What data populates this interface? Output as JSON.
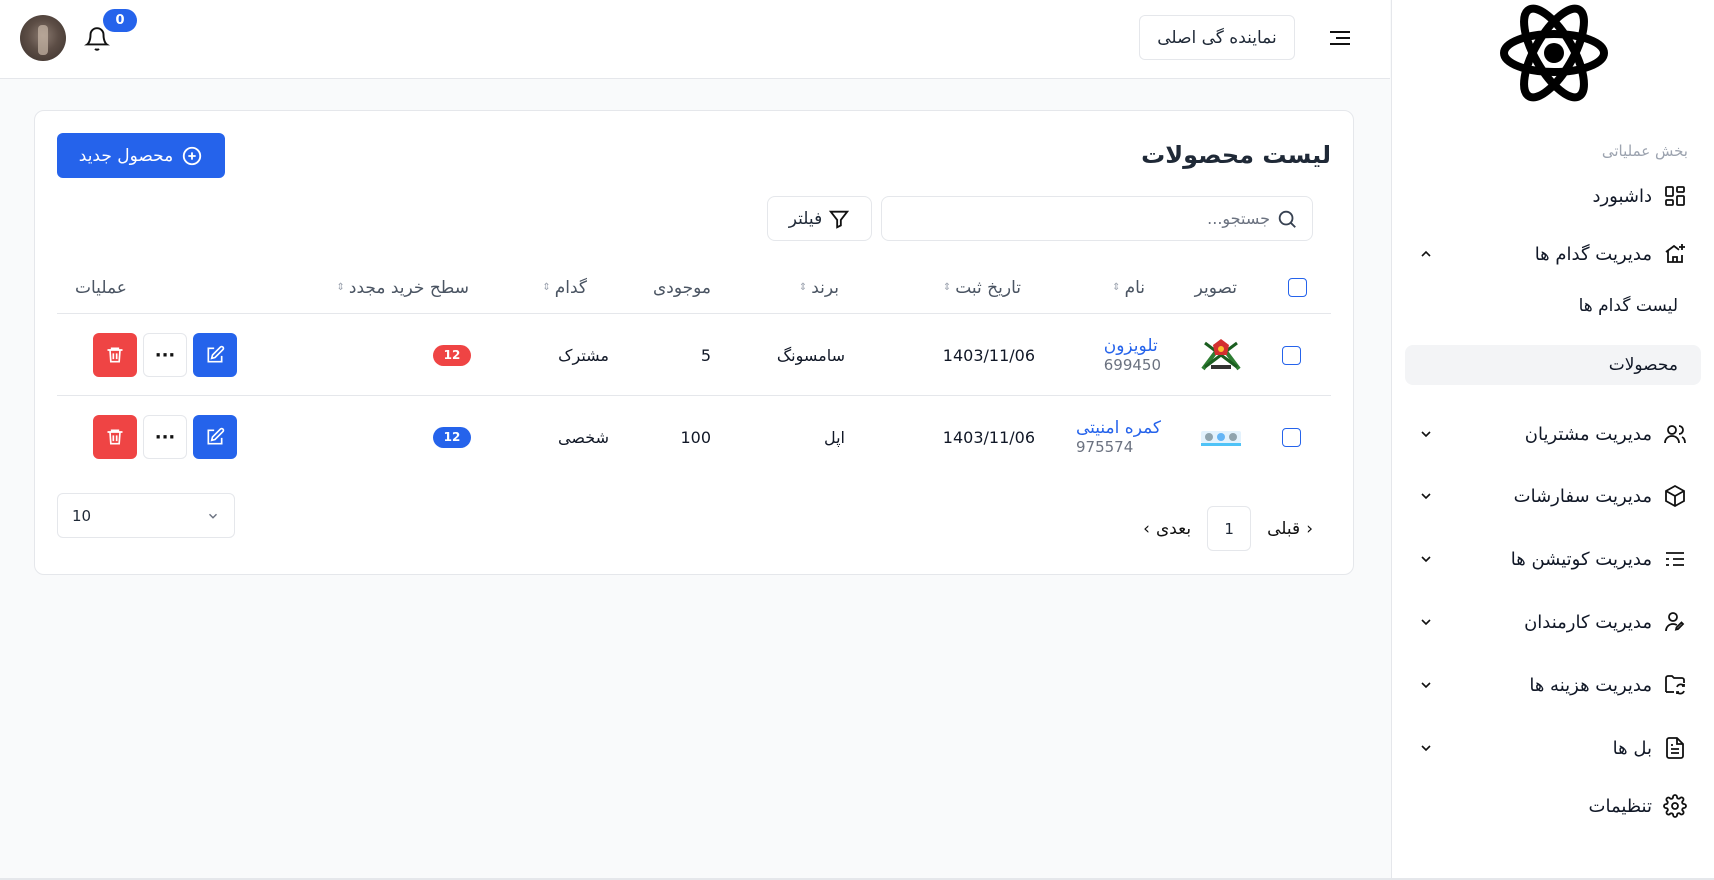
{
  "header": {
    "agency_label": "نماینده گی اصلی",
    "notification_count": "0"
  },
  "sidebar": {
    "section_label": "بخش عملیاتی",
    "items": [
      {
        "label": "داشبورد",
        "icon": "dashboard-grid-icon"
      },
      {
        "label": "مدیریت گدام ها",
        "icon": "warehouse-plus-icon",
        "expanded": true
      },
      {
        "label": "مدیریت مشتریان",
        "icon": "users-icon"
      },
      {
        "label": "مدیریت سفارشات",
        "icon": "box-icon"
      },
      {
        "label": "مدیریت کوتیشن ها",
        "icon": "list-icon"
      },
      {
        "label": "مدیریت کارمندان",
        "icon": "user-pen-icon"
      },
      {
        "label": "مدیریت هزینه ها",
        "icon": "folder-sync-icon"
      },
      {
        "label": "بل ها",
        "icon": "file-text-icon"
      },
      {
        "label": "تنظیمات",
        "icon": "gear-icon"
      }
    ],
    "sub_items": [
      {
        "label": "لیست گدام ها"
      },
      {
        "label": "محصولات",
        "active": true
      }
    ]
  },
  "main": {
    "title": "لیست محصولات",
    "new_button": "محصول جدید",
    "search_placeholder": "جستجو...",
    "filter_label": "فیلتر",
    "columns": {
      "image": "تصویر",
      "name": "نام",
      "date": "تاریخ ثبت",
      "brand": "برند",
      "stock": "موجودی",
      "warehouse": "گدام",
      "reorder": "سطح خرید مجدد",
      "actions": "عملیات"
    },
    "rows": [
      {
        "name": "تلویزون",
        "code": "699450",
        "date": "1403/11/06",
        "brand": "سامسونگ",
        "stock": "5",
        "warehouse": "مشترک",
        "reorder": "12",
        "reorder_color": "#ef4444"
      },
      {
        "name": "کمره امنیتی",
        "code": "975574",
        "date": "1403/11/06",
        "brand": "اپل",
        "stock": "100",
        "warehouse": "شخصی",
        "reorder": "12",
        "reorder_color": "#2563eb"
      }
    ],
    "pagination": {
      "prev": "قبلی",
      "page": "1",
      "next": "بعدی",
      "page_size": "10"
    }
  },
  "colors": {
    "accent": "#2563eb",
    "danger": "#ef4444"
  }
}
